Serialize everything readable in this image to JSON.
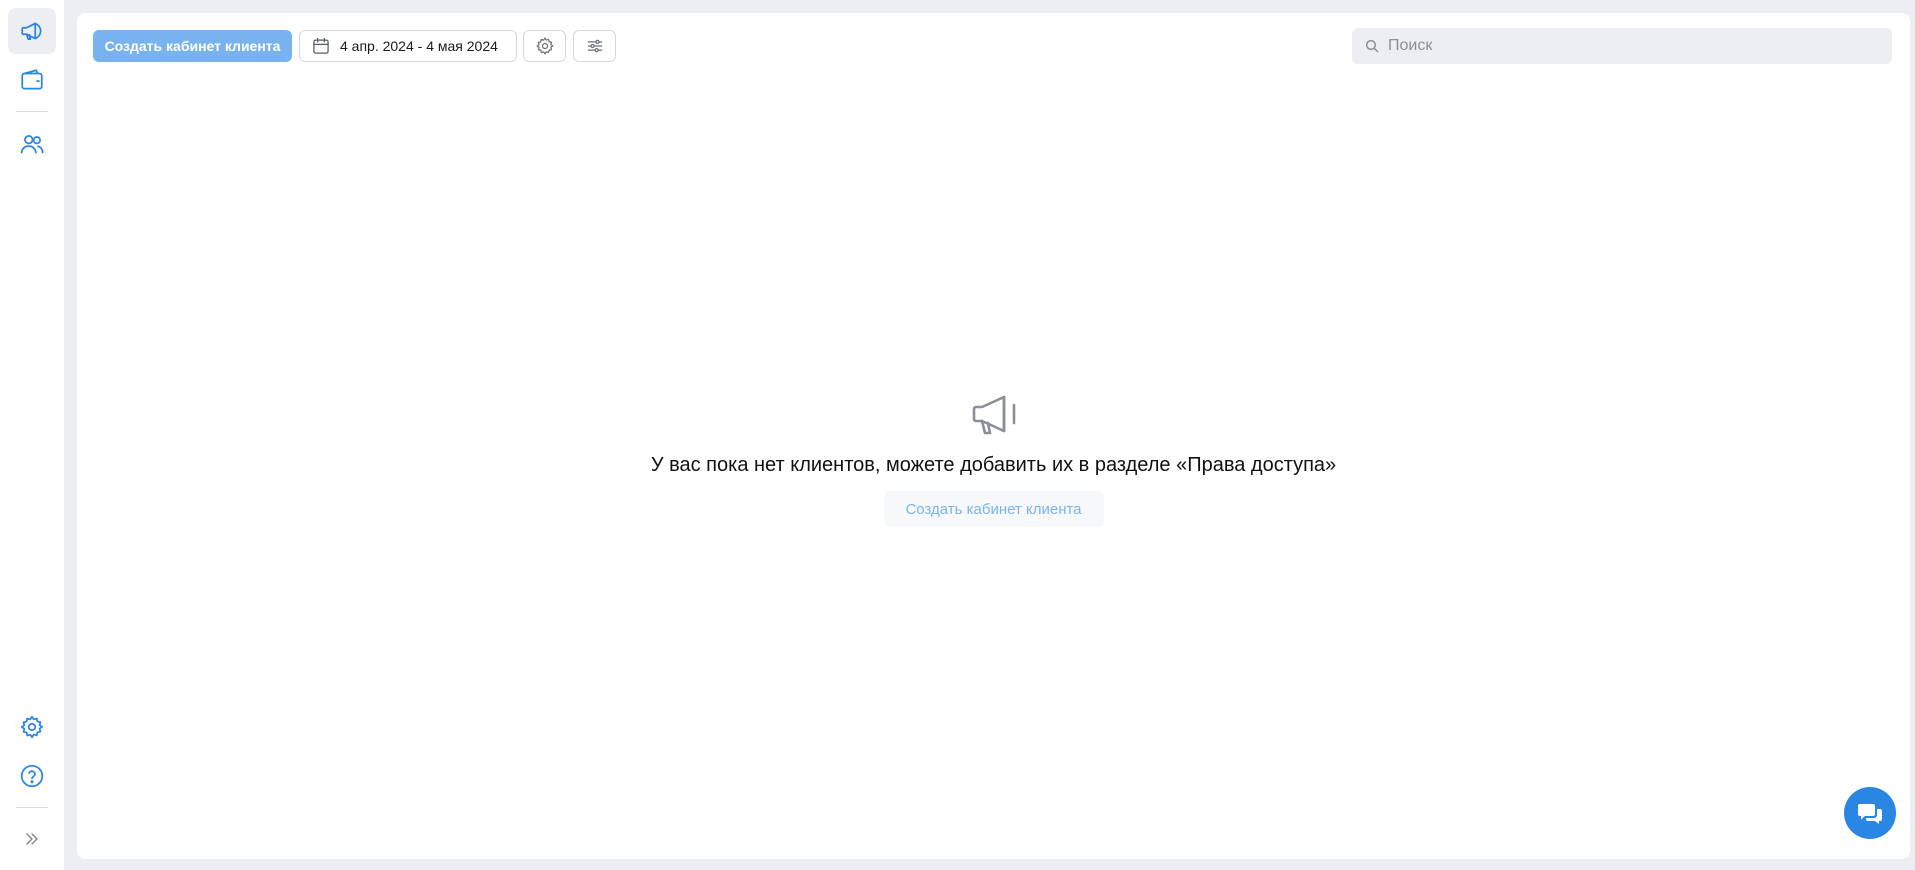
{
  "sidebar": {
    "items": [
      {
        "icon": "megaphone-icon",
        "active": true
      },
      {
        "icon": "wallet-icon"
      },
      {
        "icon": "users-icon"
      }
    ],
    "bottom_items": [
      {
        "icon": "gear-icon"
      },
      {
        "icon": "help-icon"
      },
      {
        "icon": "expand-icon"
      }
    ]
  },
  "toolbar": {
    "create_label": "Создать кабинет клиента",
    "date_range": "4 апр. 2024 - 4 мая 2024"
  },
  "search": {
    "placeholder": "Поиск",
    "value": ""
  },
  "empty_state": {
    "icon": "megaphone-icon",
    "message": "У вас пока нет клиентов, можете добавить их в разделе «Права доступа»",
    "button_label": "Создать кабинет клиента"
  },
  "colors": {
    "accent": "#2a86e3",
    "primary_button": "#78b2ef",
    "background": "#edeef1"
  }
}
